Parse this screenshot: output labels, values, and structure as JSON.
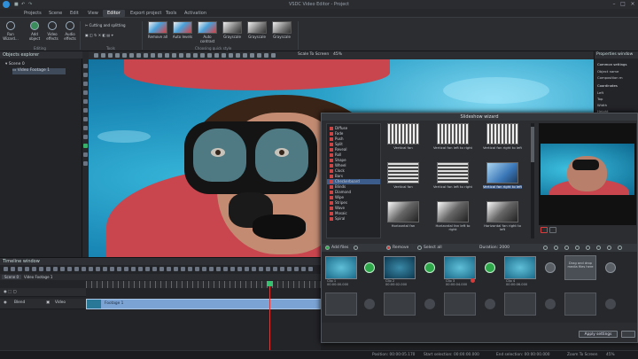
{
  "window": {
    "title": "VSDC Video Editor - Project"
  },
  "menu": {
    "tabs": [
      "Projects",
      "Scene",
      "Edit",
      "View",
      "Editor",
      "Export project",
      "Tools",
      "Activation"
    ],
    "active_index": 4
  },
  "ribbon": {
    "buttons": [
      {
        "label": "Run Wizard...",
        "icon": "wand-icon"
      },
      {
        "label": "Add object",
        "icon": "add-object-icon"
      },
      {
        "label": "Video effects",
        "icon": "video-effects-icon"
      },
      {
        "label": "Audio effects",
        "icon": "audio-effects-icon"
      }
    ],
    "editing_group": "Editing",
    "tools_group": "Tools",
    "cutting_label": "Cutting and splitting",
    "quick_style_group": "Choosing quick style",
    "styles": [
      "Remove all",
      "Auto levels",
      "Auto contrast",
      "Grayscale",
      "Grayscale",
      "Grayscale"
    ]
  },
  "left_panel": {
    "title": "Objects explorer",
    "items": [
      "Scene 0",
      "Video Footage 1"
    ],
    "tabs": [
      "Projects explorer",
      "Objects explorer"
    ]
  },
  "canvas_bar": {
    "zoom_label": "Scale To Screen",
    "zoom_value": "45%"
  },
  "dialog": {
    "title": "Slideshow wizard",
    "effect_list": [
      "Diffuse",
      "Fade",
      "Push",
      "Split",
      "Reveal",
      "Roll",
      "Shape",
      "Wheel",
      "Clock",
      "Bars",
      "Checkerboard",
      "Blinds",
      "Diamond",
      "Wipe",
      "Stripes",
      "Wave",
      "Mosaic",
      "Spiral"
    ],
    "selected_effect": 10,
    "templates": [
      {
        "label": "Vertical fan",
        "style": "v1"
      },
      {
        "label": "Vertical fan left to right",
        "style": "v1"
      },
      {
        "label": "Vertical fan right to left",
        "style": "v1"
      },
      {
        "label": "Vertical fan",
        "style": "v2"
      },
      {
        "label": "Vertical fan left to right",
        "style": "v2"
      },
      {
        "label": "Vertical fan right to left",
        "style": "sel"
      },
      {
        "label": "Horizontal fan",
        "style": "v3"
      },
      {
        "label": "Horizontal fan left to right",
        "style": "v3"
      },
      {
        "label": "Horizontal fan right to left",
        "style": "v3"
      }
    ],
    "selected_template": 5,
    "toolbar": {
      "add_files": "Add files",
      "remove": "Remove",
      "select_all": "Select all",
      "duration_label": "Duration: 2000"
    },
    "clips": [
      {
        "name": "Clip 1",
        "meta": "00:00:00.000"
      },
      {
        "name": "Clip 2",
        "meta": "00:00:02.000"
      },
      {
        "name": "Clip 3",
        "meta": "00:00:04.000"
      },
      {
        "name": "Clip 4",
        "meta": "00:00:06.000"
      }
    ],
    "drop_text": "Drag and drop media files here",
    "apply_label": "Apply settings"
  },
  "properties": {
    "title": "Properties window",
    "rows": [
      "Common settings",
      "Object name",
      "Composition m",
      "Coordinates",
      "Left",
      "Top",
      "Width",
      "Height"
    ]
  },
  "timeline": {
    "title": "Timeline window",
    "tabs": [
      "Scene 0",
      "Video Footage 1"
    ],
    "track_labels": [
      "Blend",
      "Video"
    ],
    "clip_label": "Footage 1"
  },
  "status": {
    "position": "Position: 00:00:05.170",
    "start": "Start selection: 00:00:00.000",
    "end": "End selection: 00:00:00.000",
    "zoom": "Zoom To Screen",
    "percent": "45%"
  },
  "colors": {
    "accent": "#2f8fd8",
    "selection": "#3c5c8c",
    "transition": "#2ea84a",
    "clip": "#7ba3d4",
    "playhead": "#d83a3a"
  }
}
